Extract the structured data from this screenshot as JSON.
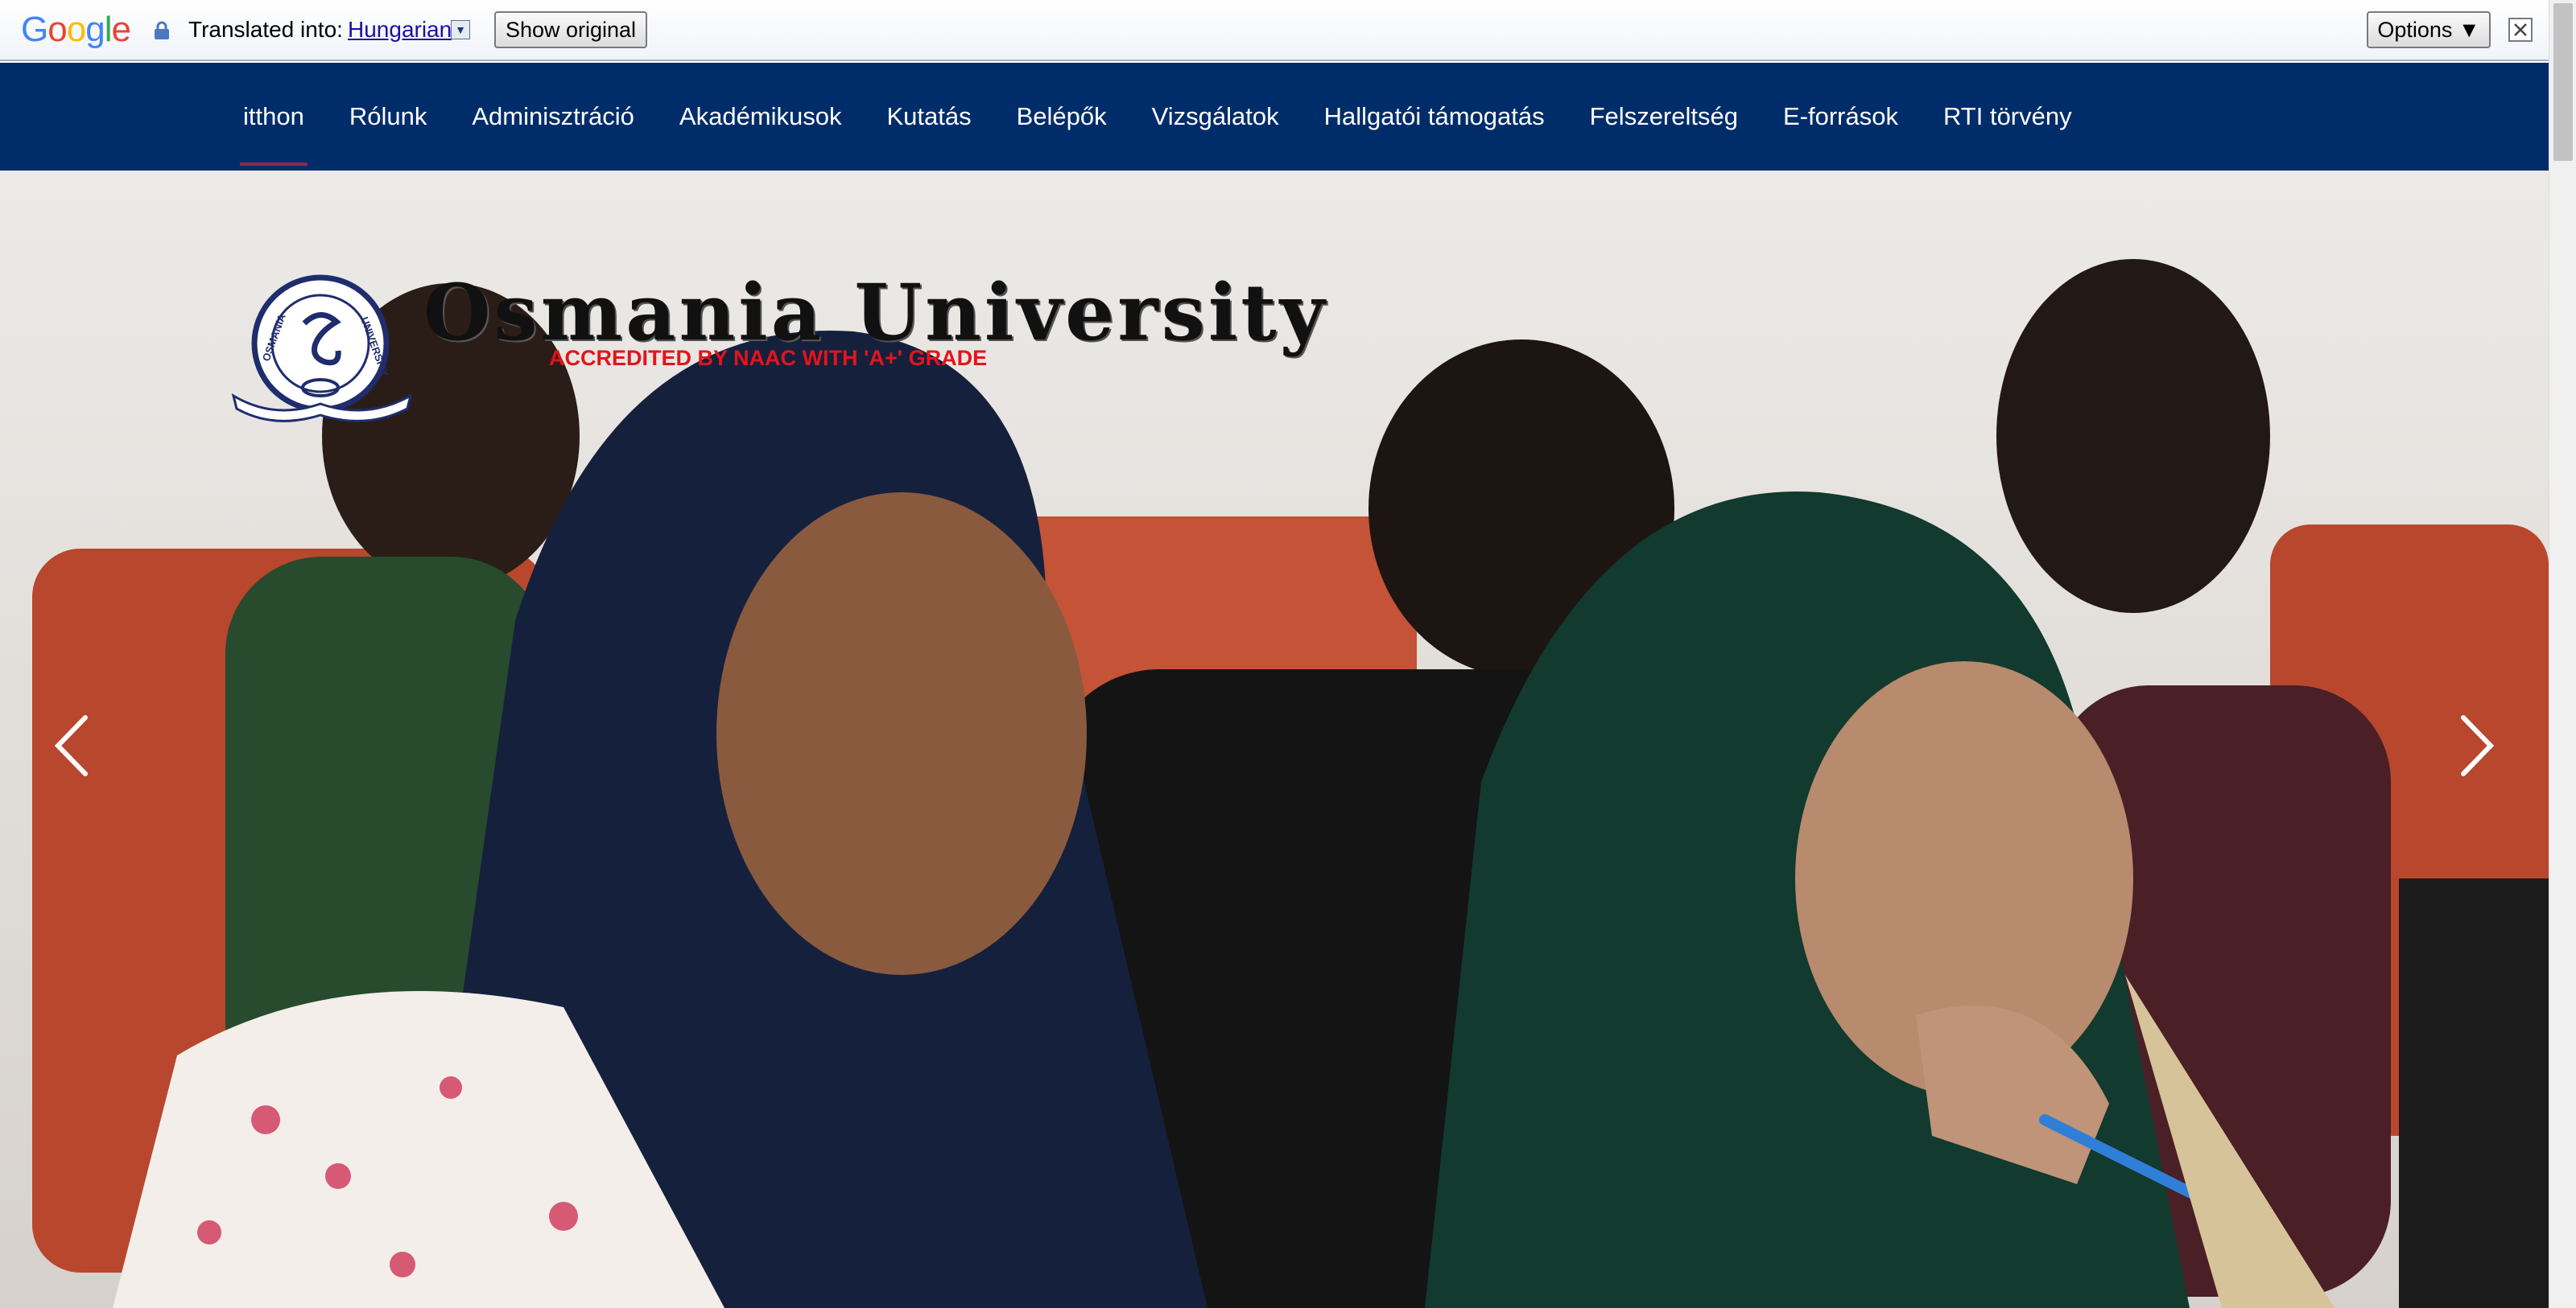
{
  "translate_bar": {
    "logo_text": "Google",
    "translated_into_label": "Translated into:",
    "language": "Hungarian",
    "show_original_label": "Show original",
    "options_label": "Options ▼"
  },
  "nav": {
    "items": [
      {
        "label": "itthon",
        "active": true
      },
      {
        "label": "Rólunk"
      },
      {
        "label": "Adminisztráció"
      },
      {
        "label": "Akadémikusok"
      },
      {
        "label": "Kutatás"
      },
      {
        "label": "Belépők"
      },
      {
        "label": "Vizsgálatok"
      },
      {
        "label": "Hallgatói támogatás"
      },
      {
        "label": "Felszereltség"
      },
      {
        "label": "E-források"
      },
      {
        "label": "RTI törvény"
      }
    ]
  },
  "hero": {
    "university_name": "Osmania University",
    "accreditation": "ACCREDITED BY NAAC WITH 'A+' GRADE",
    "logo_ring_text": "OSMANIA UNIVERSITY",
    "icons": {
      "prev": "chevron-left-icon",
      "next": "chevron-right-icon"
    }
  },
  "colors": {
    "nav_background": "#002d6a",
    "nav_text": "#ffffff",
    "accreditation_red": "#e3141b",
    "link_blue": "#1a0dab"
  }
}
